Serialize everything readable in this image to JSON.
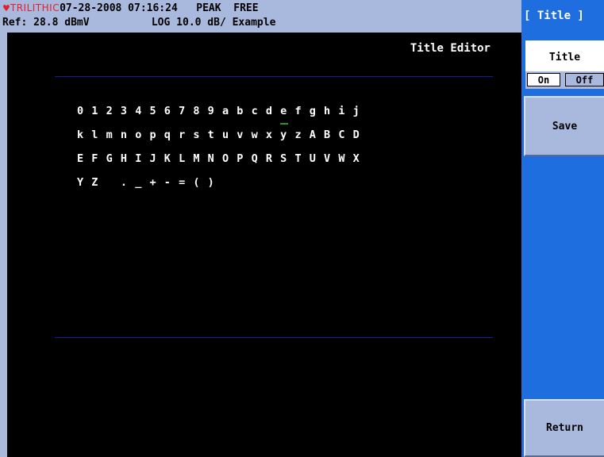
{
  "status": {
    "brand": "TRILITHIC",
    "datetime": "07-28-2008 07:16:24",
    "mode1": "PEAK",
    "mode2": "FREE",
    "ref": "Ref: 28.8 dBmV",
    "scale": "LOG 10.0 dB/ Example"
  },
  "editor": {
    "heading": "Title Editor",
    "rows": [
      [
        "0",
        "1",
        "2",
        "3",
        "4",
        "5",
        "6",
        "7",
        "8",
        "9",
        "a",
        "b",
        "c",
        "d",
        "e",
        "f",
        "g",
        "h",
        "i",
        "j"
      ],
      [
        "k",
        "l",
        "m",
        "n",
        "o",
        "p",
        "q",
        "r",
        "s",
        "t",
        "u",
        "v",
        "w",
        "x",
        "y",
        "z",
        "A",
        "B",
        "C",
        "D"
      ],
      [
        "E",
        "F",
        "G",
        "H",
        "I",
        "J",
        "K",
        "L",
        "M",
        "N",
        "O",
        "P",
        "Q",
        "R",
        "S",
        "T",
        "U",
        "V",
        "W",
        "X"
      ],
      [
        "Y",
        "Z",
        " ",
        ".",
        "_",
        "+",
        "-",
        "=",
        "(",
        ")"
      ]
    ],
    "selected_char": "e"
  },
  "softkeys": {
    "header": "[ Title ]",
    "title_label": "Title",
    "on_label": "On",
    "off_label": "Off",
    "save_label": "Save",
    "return_label": "Return"
  },
  "colors": {
    "status_bg": "#a9b9dd",
    "softkey_bg": "#1e6ee0",
    "brand": "#e0202a",
    "cursor": "#1aa01a"
  }
}
